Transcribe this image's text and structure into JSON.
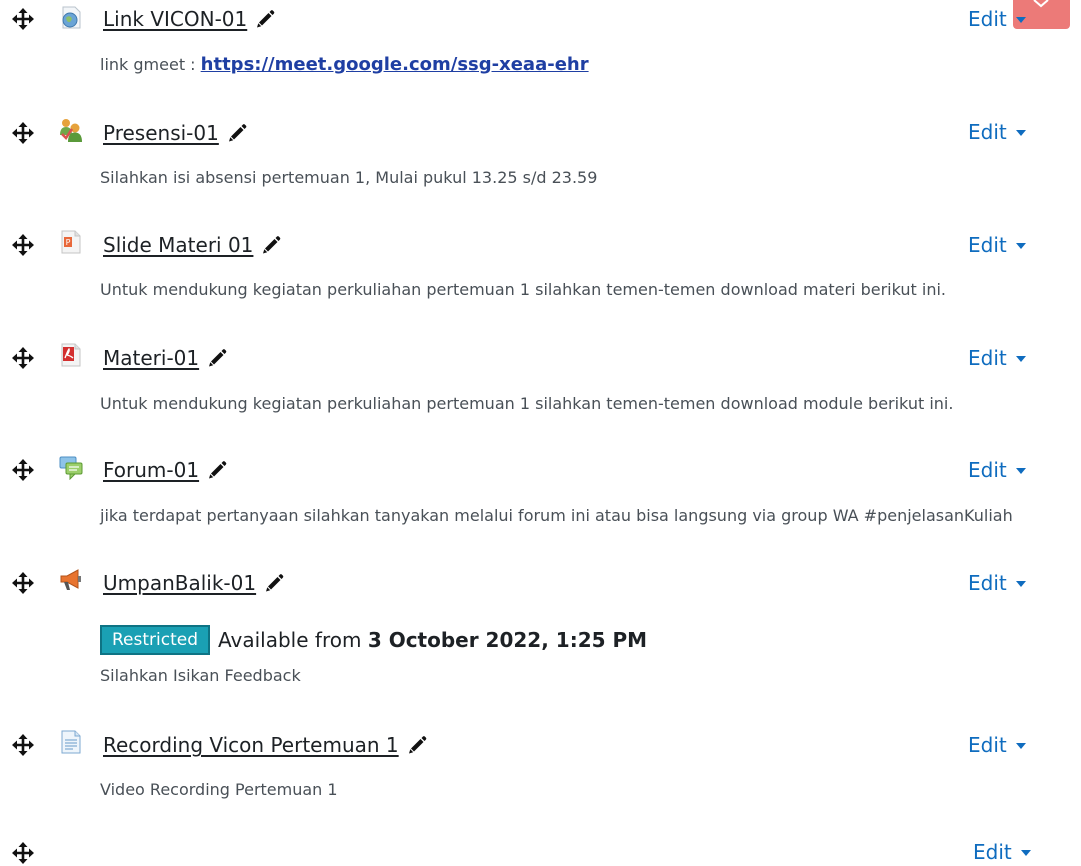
{
  "edit_label": "Edit",
  "activities": [
    {
      "icon": "url-globe-icon",
      "title": "Link VICON-01",
      "desc_prefix": "link gmeet : ",
      "desc_link": "https://meet.google.com/ssg-xeaa-ehr"
    },
    {
      "icon": "attendance-icon",
      "title": "Presensi-01",
      "desc": "Silahkan isi absensi pertemuan 1, Mulai pukul 13.25 s/d 23.59"
    },
    {
      "icon": "powerpoint-file-icon",
      "title": "Slide Materi 01",
      "desc": "Untuk mendukung kegiatan perkuliahan pertemuan 1 silahkan temen-temen download materi berikut ini."
    },
    {
      "icon": "pdf-file-icon",
      "title": "Materi-01",
      "desc": "Untuk mendukung kegiatan perkuliahan pertemuan 1 silahkan temen-temen download  module berikut ini."
    },
    {
      "icon": "forum-icon",
      "title": "Forum-01",
      "desc": "jika terdapat pertanyaan silahkan tanyakan melalui forum ini atau bisa langsung via group WA #penjelasanKuliah"
    },
    {
      "icon": "feedback-megaphone-icon",
      "title": "UmpanBalik-01",
      "restriction_badge": "Restricted",
      "availability_prefix": "Available from ",
      "availability_date": "3 October 2022, 1:25 PM",
      "desc": "Silahkan Isikan Feedback"
    },
    {
      "icon": "page-document-icon",
      "title": "Recording Vicon Pertemuan 1",
      "desc": "Video Recording Pertemuan 1"
    }
  ]
}
